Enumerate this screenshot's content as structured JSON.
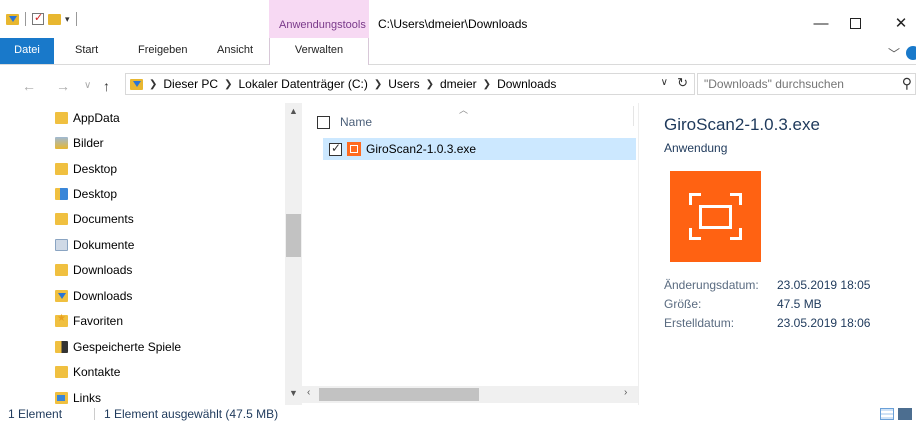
{
  "titlebar": {
    "context_tab_group": "Anwendungstools",
    "window_title": "C:\\Users\\dmeier\\Downloads"
  },
  "ribbon": {
    "tabs": [
      {
        "label": "Datei"
      },
      {
        "label": "Start"
      },
      {
        "label": "Freigeben"
      },
      {
        "label": "Ansicht"
      },
      {
        "label": "Verwalten"
      }
    ]
  },
  "address": {
    "crumbs": [
      "Dieser PC",
      "Lokaler Datenträger (C:)",
      "Users",
      "dmeier",
      "Downloads"
    ],
    "search_placeholder": "\"Downloads\" durchsuchen"
  },
  "navpane": {
    "items": [
      {
        "label": "AppData",
        "icon": "folder-icon"
      },
      {
        "label": "Bilder",
        "icon": "pictures-folder-icon"
      },
      {
        "label": "Desktop",
        "icon": "folder-icon"
      },
      {
        "label": "Desktop",
        "icon": "desktop-folder-icon"
      },
      {
        "label": "Documents",
        "icon": "folder-icon"
      },
      {
        "label": "Dokumente",
        "icon": "documents-folder-icon"
      },
      {
        "label": "Downloads",
        "icon": "folder-icon"
      },
      {
        "label": "Downloads",
        "icon": "downloads-folder-icon"
      },
      {
        "label": "Favoriten",
        "icon": "favorites-folder-icon"
      },
      {
        "label": "Gespeicherte Spiele",
        "icon": "saved-games-folder-icon"
      },
      {
        "label": "Kontakte",
        "icon": "contacts-folder-icon"
      },
      {
        "label": "Links",
        "icon": "links-folder-icon"
      }
    ]
  },
  "filelist": {
    "column_name": "Name",
    "files": [
      {
        "name": "GiroScan2-1.0.3.exe",
        "selected": true
      }
    ]
  },
  "details": {
    "title": "GiroScan2-1.0.3.exe",
    "type": "Anwendung",
    "props": [
      {
        "label": "Änderungsdatum:",
        "value": "23.05.2019 18:05"
      },
      {
        "label": "Größe:",
        "value": "47.5 MB"
      },
      {
        "label": "Erstelldatum:",
        "value": "23.05.2019 18:06"
      }
    ]
  },
  "status": {
    "count": "1 Element",
    "selection": "1 Element ausgewählt (47.5 MB)"
  },
  "colors": {
    "ribbon_file_tab": "#1979ca",
    "context_tab": "#f7d9f3",
    "selection": "#cce8ff",
    "app_icon": "#ff6212"
  }
}
